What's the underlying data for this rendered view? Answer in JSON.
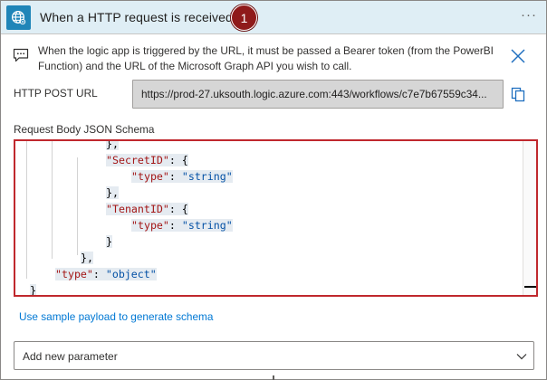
{
  "header": {
    "title": "When a HTTP request is received",
    "badge": "1",
    "more_label": "···",
    "icon": "globe-icon"
  },
  "info": {
    "icon": "comment-icon",
    "line1": "When the logic app is triggered by the URL, it must be passed a Bearer token (from the PowerBI",
    "line2": "Function) and the URL of the Microsoft Graph API you wish to call.",
    "close_icon": "close-icon"
  },
  "http_post_url": {
    "label": "HTTP POST URL",
    "value": "https://prod-27.uksouth.logic.azure.com:443/workflows/c7e7b67559c34...",
    "copy_icon": "copy-icon"
  },
  "schema": {
    "label": "Request Body JSON Schema",
    "lines": [
      {
        "indent": "            ",
        "tokens": [
          {
            "t": "},",
            "c": "p"
          }
        ]
      },
      {
        "indent": "            ",
        "tokens": [
          {
            "t": "\"SecretID\"",
            "c": "k"
          },
          {
            "t": ": {",
            "c": "p"
          }
        ]
      },
      {
        "indent": "                ",
        "tokens": [
          {
            "t": "\"type\"",
            "c": "k"
          },
          {
            "t": ": ",
            "c": "p"
          },
          {
            "t": "\"string\"",
            "c": "s"
          }
        ]
      },
      {
        "indent": "            ",
        "tokens": [
          {
            "t": "},",
            "c": "p"
          }
        ]
      },
      {
        "indent": "            ",
        "tokens": [
          {
            "t": "\"TenantID\"",
            "c": "k"
          },
          {
            "t": ": {",
            "c": "p"
          }
        ]
      },
      {
        "indent": "                ",
        "tokens": [
          {
            "t": "\"type\"",
            "c": "k"
          },
          {
            "t": ": ",
            "c": "p"
          },
          {
            "t": "\"string\"",
            "c": "s"
          }
        ]
      },
      {
        "indent": "            ",
        "tokens": [
          {
            "t": "}",
            "c": "p"
          }
        ]
      },
      {
        "indent": "        ",
        "tokens": [
          {
            "t": "},",
            "c": "p"
          }
        ]
      },
      {
        "indent": "    ",
        "tokens": [
          {
            "t": "\"type\"",
            "c": "k"
          },
          {
            "t": ": ",
            "c": "p"
          },
          {
            "t": "\"object\"",
            "c": "s"
          }
        ]
      },
      {
        "indent": "",
        "tokens": [
          {
            "t": "}",
            "c": "p"
          }
        ]
      }
    ]
  },
  "sample_link": "Use sample payload to generate schema",
  "add_parameter": {
    "label": "Add new parameter",
    "icon": "chevron-down-icon"
  },
  "colors": {
    "header_bg": "#dfeef5",
    "trigger_icon_bg": "#1f85b8",
    "badge_bg": "#8f1a1a",
    "editor_border": "#c0282d",
    "link": "#0078d4",
    "json_key": "#a31515",
    "json_string": "#0451a5"
  }
}
